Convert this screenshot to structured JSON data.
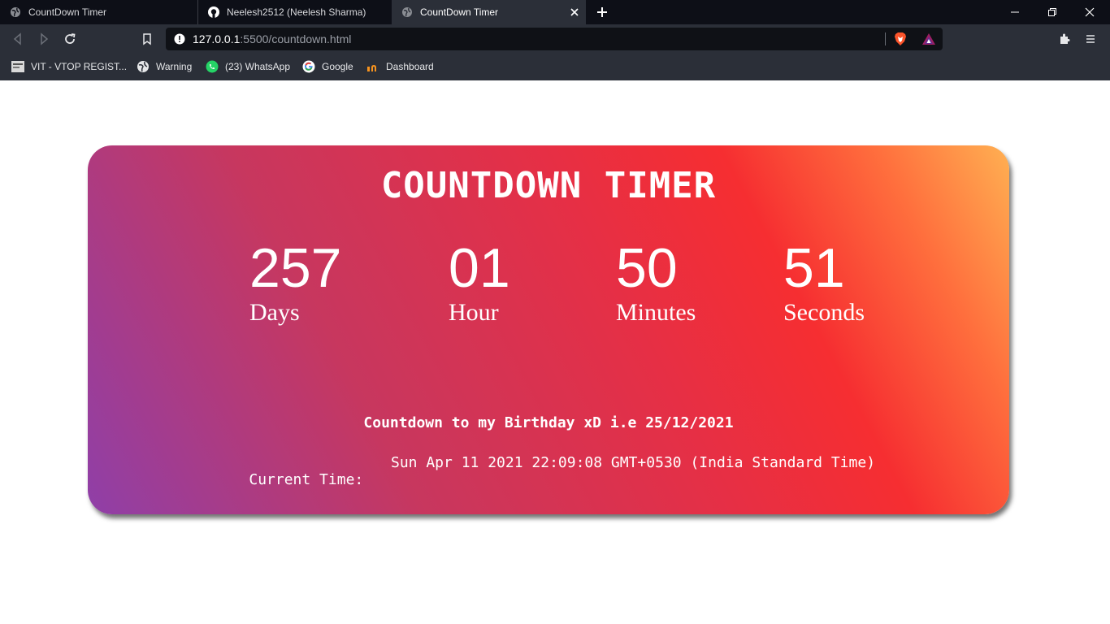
{
  "browser": {
    "tabs": [
      {
        "title": "CountDown Timer"
      },
      {
        "title": "Neelesh2512 (Neelesh Sharma)"
      },
      {
        "title": "CountDown Timer"
      }
    ],
    "url_host": "127.0.0.1",
    "url_rest": ":5500/countdown.html",
    "bookmarks": [
      {
        "label": "VIT - VTOP REGIST..."
      },
      {
        "label": "Warning"
      },
      {
        "label": "(23) WhatsApp"
      },
      {
        "label": "Google"
      },
      {
        "label": "Dashboard"
      }
    ]
  },
  "page": {
    "title": "COUNTDOWN TIMER",
    "units": [
      {
        "value": "257",
        "label": "Days"
      },
      {
        "value": "01",
        "label": "Hour"
      },
      {
        "value": "50",
        "label": "Minutes"
      },
      {
        "value": "51",
        "label": "Seconds"
      }
    ],
    "note": "Countdown to my Birthday xD i.e 25/12/2021",
    "current_label": "Current Time:",
    "current_value": "Sun Apr 11 2021 22:09:08 GMT+0530 (India Standard Time)"
  }
}
